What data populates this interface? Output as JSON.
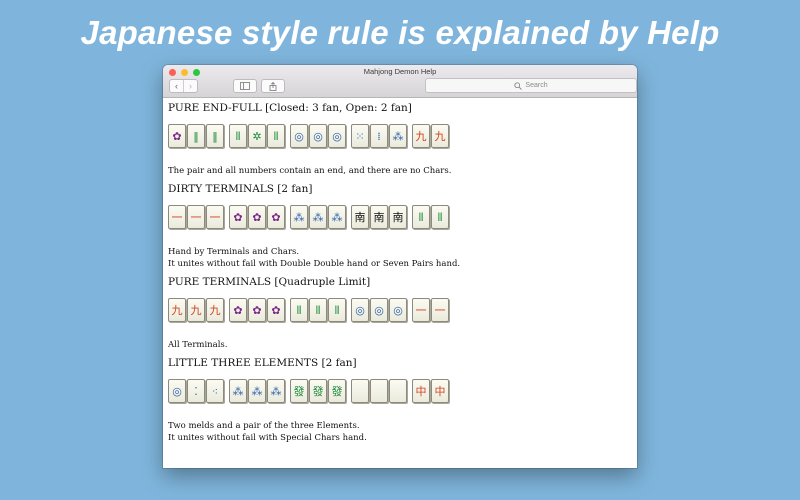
{
  "banner": "Japanese style rule is explained by Help",
  "window": {
    "title": "Mahjong Demon Help",
    "search_placeholder": "Search",
    "icons": [
      "back-icon",
      "forward-icon",
      "sidebar-icon",
      "share-icon",
      "search-icon"
    ]
  },
  "colors": {
    "background": "#7fb5dc",
    "character_tile": "#d2451f",
    "bamboo_tile": "#1f8a3a",
    "circle_tile": "#2a5ea8",
    "flower_tile": "#7a2a86"
  },
  "sections": [
    {
      "heading": "PURE END-FULL [Closed: 3 fan, Open: 2 fan]",
      "groups": [
        [
          {
            "g": "✿",
            "c": "#7a2a86"
          },
          {
            "g": "‖",
            "c": "#1f8a3a"
          },
          {
            "g": "‖",
            "c": "#1f8a3a"
          }
        ],
        [
          {
            "g": "⦀",
            "c": "#1f8a3a"
          },
          {
            "g": "✲",
            "c": "#1f8a3a"
          },
          {
            "g": "⦀",
            "c": "#1f8a3a"
          }
        ],
        [
          {
            "g": "◎",
            "c": "#2a5ea8"
          },
          {
            "g": "◎",
            "c": "#2a5ea8"
          },
          {
            "g": "◎",
            "c": "#2a5ea8"
          }
        ],
        [
          {
            "g": "⁙",
            "c": "#2a5ea8"
          },
          {
            "g": "⁞",
            "c": "#2a5ea8"
          },
          {
            "g": "⁂",
            "c": "#2a5ea8"
          }
        ],
        [
          {
            "g": "九",
            "c": "#d2451f"
          },
          {
            "g": "九",
            "c": "#d2451f"
          }
        ]
      ],
      "lines": [
        "The pair and all numbers contain an end, and there are no Chars."
      ]
    },
    {
      "heading": "DIRTY TERMINALS [2 fan]",
      "groups": [
        [
          {
            "g": "一",
            "c": "#d2451f"
          },
          {
            "g": "一",
            "c": "#d2451f"
          },
          {
            "g": "一",
            "c": "#d2451f"
          }
        ],
        [
          {
            "g": "✿",
            "c": "#7a2a86"
          },
          {
            "g": "✿",
            "c": "#7a2a86"
          },
          {
            "g": "✿",
            "c": "#7a2a86"
          }
        ],
        [
          {
            "g": "⁂",
            "c": "#2a5ea8"
          },
          {
            "g": "⁂",
            "c": "#2a5ea8"
          },
          {
            "g": "⁂",
            "c": "#2a5ea8"
          }
        ],
        [
          {
            "g": "南",
            "c": "#111111"
          },
          {
            "g": "南",
            "c": "#111111"
          },
          {
            "g": "南",
            "c": "#111111"
          }
        ],
        [
          {
            "g": "⦀",
            "c": "#1f8a3a"
          },
          {
            "g": "⦀",
            "c": "#1f8a3a"
          }
        ]
      ],
      "lines": [
        "Hand by Terminals and Chars.",
        "It unites without fail with Double Double hand or Seven Pairs hand."
      ]
    },
    {
      "heading": "PURE TERMINALS [Quadruple Limit]",
      "groups": [
        [
          {
            "g": "九",
            "c": "#d2451f"
          },
          {
            "g": "九",
            "c": "#d2451f"
          },
          {
            "g": "九",
            "c": "#d2451f"
          }
        ],
        [
          {
            "g": "✿",
            "c": "#7a2a86"
          },
          {
            "g": "✿",
            "c": "#7a2a86"
          },
          {
            "g": "✿",
            "c": "#7a2a86"
          }
        ],
        [
          {
            "g": "⦀",
            "c": "#1f8a3a"
          },
          {
            "g": "⦀",
            "c": "#1f8a3a"
          },
          {
            "g": "⦀",
            "c": "#1f8a3a"
          }
        ],
        [
          {
            "g": "◎",
            "c": "#2a5ea8"
          },
          {
            "g": "◎",
            "c": "#2a5ea8"
          },
          {
            "g": "◎",
            "c": "#2a5ea8"
          }
        ],
        [
          {
            "g": "一",
            "c": "#d2451f"
          },
          {
            "g": "一",
            "c": "#d2451f"
          }
        ]
      ],
      "lines": [
        "All Terminals."
      ]
    },
    {
      "heading": "LITTLE THREE ELEMENTS [2 fan]",
      "groups": [
        [
          {
            "g": "◎",
            "c": "#2a5ea8"
          },
          {
            "g": "⁚",
            "c": "#2a5ea8"
          },
          {
            "g": "⁖",
            "c": "#2a5ea8"
          }
        ],
        [
          {
            "g": "⁂",
            "c": "#2a5ea8"
          },
          {
            "g": "⁂",
            "c": "#2a5ea8"
          },
          {
            "g": "⁂",
            "c": "#2a5ea8"
          }
        ],
        [
          {
            "g": "發",
            "c": "#1f8a3a"
          },
          {
            "g": "發",
            "c": "#1f8a3a"
          },
          {
            "g": "發",
            "c": "#1f8a3a"
          }
        ],
        [
          {
            "g": "",
            "c": "#111111"
          },
          {
            "g": "",
            "c": "#111111"
          },
          {
            "g": "",
            "c": "#111111"
          }
        ],
        [
          {
            "g": "中",
            "c": "#d2451f"
          },
          {
            "g": "中",
            "c": "#d2451f"
          }
        ]
      ],
      "lines": [
        "Two melds and a pair of the three Elements.",
        "It unites without fail with Special Chars hand."
      ]
    }
  ]
}
